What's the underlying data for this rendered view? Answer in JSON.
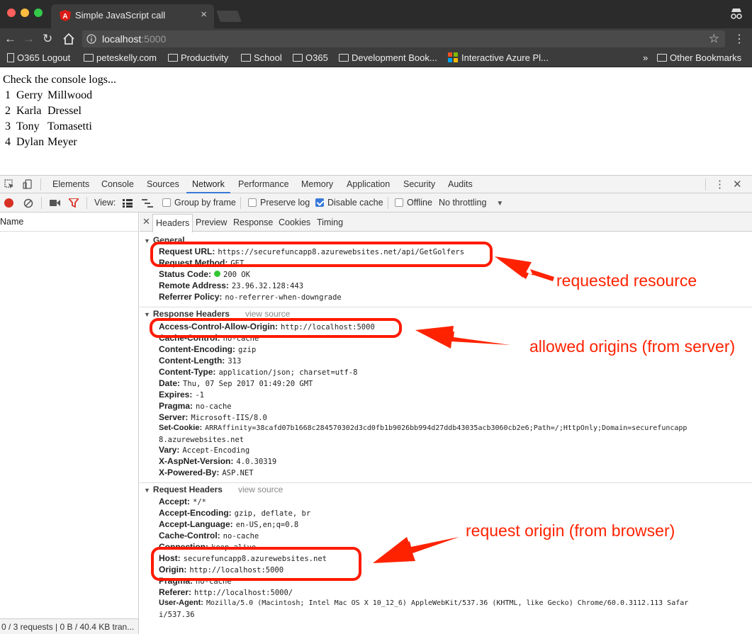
{
  "browser": {
    "tab_title": "Simple JavaScript call",
    "tab_close": "×",
    "url_host": "localhost",
    "url_port": ":5000",
    "bookmarks": [
      {
        "label": "O365 Logout",
        "icon": "doc"
      },
      {
        "label": "peteskelly.com",
        "icon": "folder"
      },
      {
        "label": "Productivity",
        "icon": "folder"
      },
      {
        "label": "School",
        "icon": "folder"
      },
      {
        "label": "O365",
        "icon": "folder"
      },
      {
        "label": "Development Book...",
        "icon": "folder"
      },
      {
        "label": "Interactive Azure Pl...",
        "icon": "ms"
      },
      {
        "label": "»",
        "icon": "none"
      },
      {
        "label": "Other Bookmarks",
        "icon": "folder"
      }
    ]
  },
  "page": {
    "heading": "Check the console logs...",
    "golfers": [
      {
        "id": "1",
        "first": "Gerry",
        "last": "Millwood"
      },
      {
        "id": "2",
        "first": "Karla",
        "last": "Dressel"
      },
      {
        "id": "3",
        "first": "Tony",
        "last": "Tomasetti"
      },
      {
        "id": "4",
        "first": "Dylan",
        "last": "Meyer"
      }
    ]
  },
  "devtools": {
    "tabs": [
      "Elements",
      "Console",
      "Sources",
      "Network",
      "Performance",
      "Memory",
      "Application",
      "Security",
      "Audits"
    ],
    "active_tab": "Network",
    "toolbar": {
      "view_label": "View:",
      "group_by_frame": "Group by frame",
      "preserve_log": "Preserve log",
      "disable_cache": "Disable cache",
      "offline": "Offline",
      "throttling": "No throttling",
      "disable_cache_checked": true
    },
    "name_header": "Name",
    "footer": "0 / 3 requests | 0 B / 40.4 KB tran...",
    "sub_tabs": [
      "Headers",
      "Preview",
      "Response",
      "Cookies",
      "Timing"
    ],
    "general": {
      "title": "General",
      "rows": [
        {
          "k": "Request URL:",
          "v": "https://securefuncapp8.azurewebsites.net/api/GetGolfers"
        },
        {
          "k": "Request Method:",
          "v": "GET"
        },
        {
          "k": "Status Code:",
          "v": "200 OK"
        },
        {
          "k": "Remote Address:",
          "v": "23.96.32.128:443"
        },
        {
          "k": "Referrer Policy:",
          "v": "no-referrer-when-downgrade"
        }
      ]
    },
    "response_headers": {
      "title": "Response Headers",
      "view_source": "view source",
      "rows": [
        {
          "k": "Access-Control-Allow-Origin:",
          "v": "http://localhost:5000"
        },
        {
          "k": "Cache-Control:",
          "v": "no-cache"
        },
        {
          "k": "Content-Encoding:",
          "v": "gzip"
        },
        {
          "k": "Content-Length:",
          "v": "313"
        },
        {
          "k": "Content-Type:",
          "v": "application/json; charset=utf-8"
        },
        {
          "k": "Date:",
          "v": "Thu, 07 Sep 2017 01:49:20 GMT"
        },
        {
          "k": "Expires:",
          "v": "-1"
        },
        {
          "k": "Pragma:",
          "v": "no-cache"
        },
        {
          "k": "Server:",
          "v": "Microsoft-IIS/8.0"
        },
        {
          "k": "Set-Cookie:",
          "v": "ARRAffinity=38cafd07b1668c284570302d3cd0fb1b9026bb994d27ddb43035acb3060cb2e6;Path=/;HttpOnly;Domain=securefuncapp"
        },
        {
          "k": "",
          "v": "8.azurewebsites.net"
        },
        {
          "k": "Vary:",
          "v": "Accept-Encoding"
        },
        {
          "k": "X-AspNet-Version:",
          "v": "4.0.30319"
        },
        {
          "k": "X-Powered-By:",
          "v": "ASP.NET"
        }
      ]
    },
    "request_headers": {
      "title": "Request Headers",
      "view_source": "view source",
      "rows": [
        {
          "k": "Accept:",
          "v": "*/*"
        },
        {
          "k": "Accept-Encoding:",
          "v": "gzip, deflate, br"
        },
        {
          "k": "Accept-Language:",
          "v": "en-US,en;q=0.8"
        },
        {
          "k": "Cache-Control:",
          "v": "no-cache"
        },
        {
          "k": "Connection:",
          "v": "keep-alive"
        },
        {
          "k": "Host:",
          "v": "securefuncapp8.azurewebsites.net"
        },
        {
          "k": "Origin:",
          "v": "http://localhost:5000"
        },
        {
          "k": "Pragma:",
          "v": "no-cache"
        },
        {
          "k": "Referer:",
          "v": "http://localhost:5000/"
        },
        {
          "k": "User-Agent:",
          "v": "Mozilla/5.0 (Macintosh; Intel Mac OS X 10_12_6) AppleWebKit/537.36 (KHTML, like Gecko) Chrome/60.0.3112.113 Safar"
        },
        {
          "k": "",
          "v": "i/537.36"
        }
      ]
    }
  },
  "annotations": {
    "requested_resource": "requested resource",
    "allowed_origins": "allowed origins (from server)",
    "request_origin": "request origin (from browser)",
    "color": "#ff2200"
  }
}
